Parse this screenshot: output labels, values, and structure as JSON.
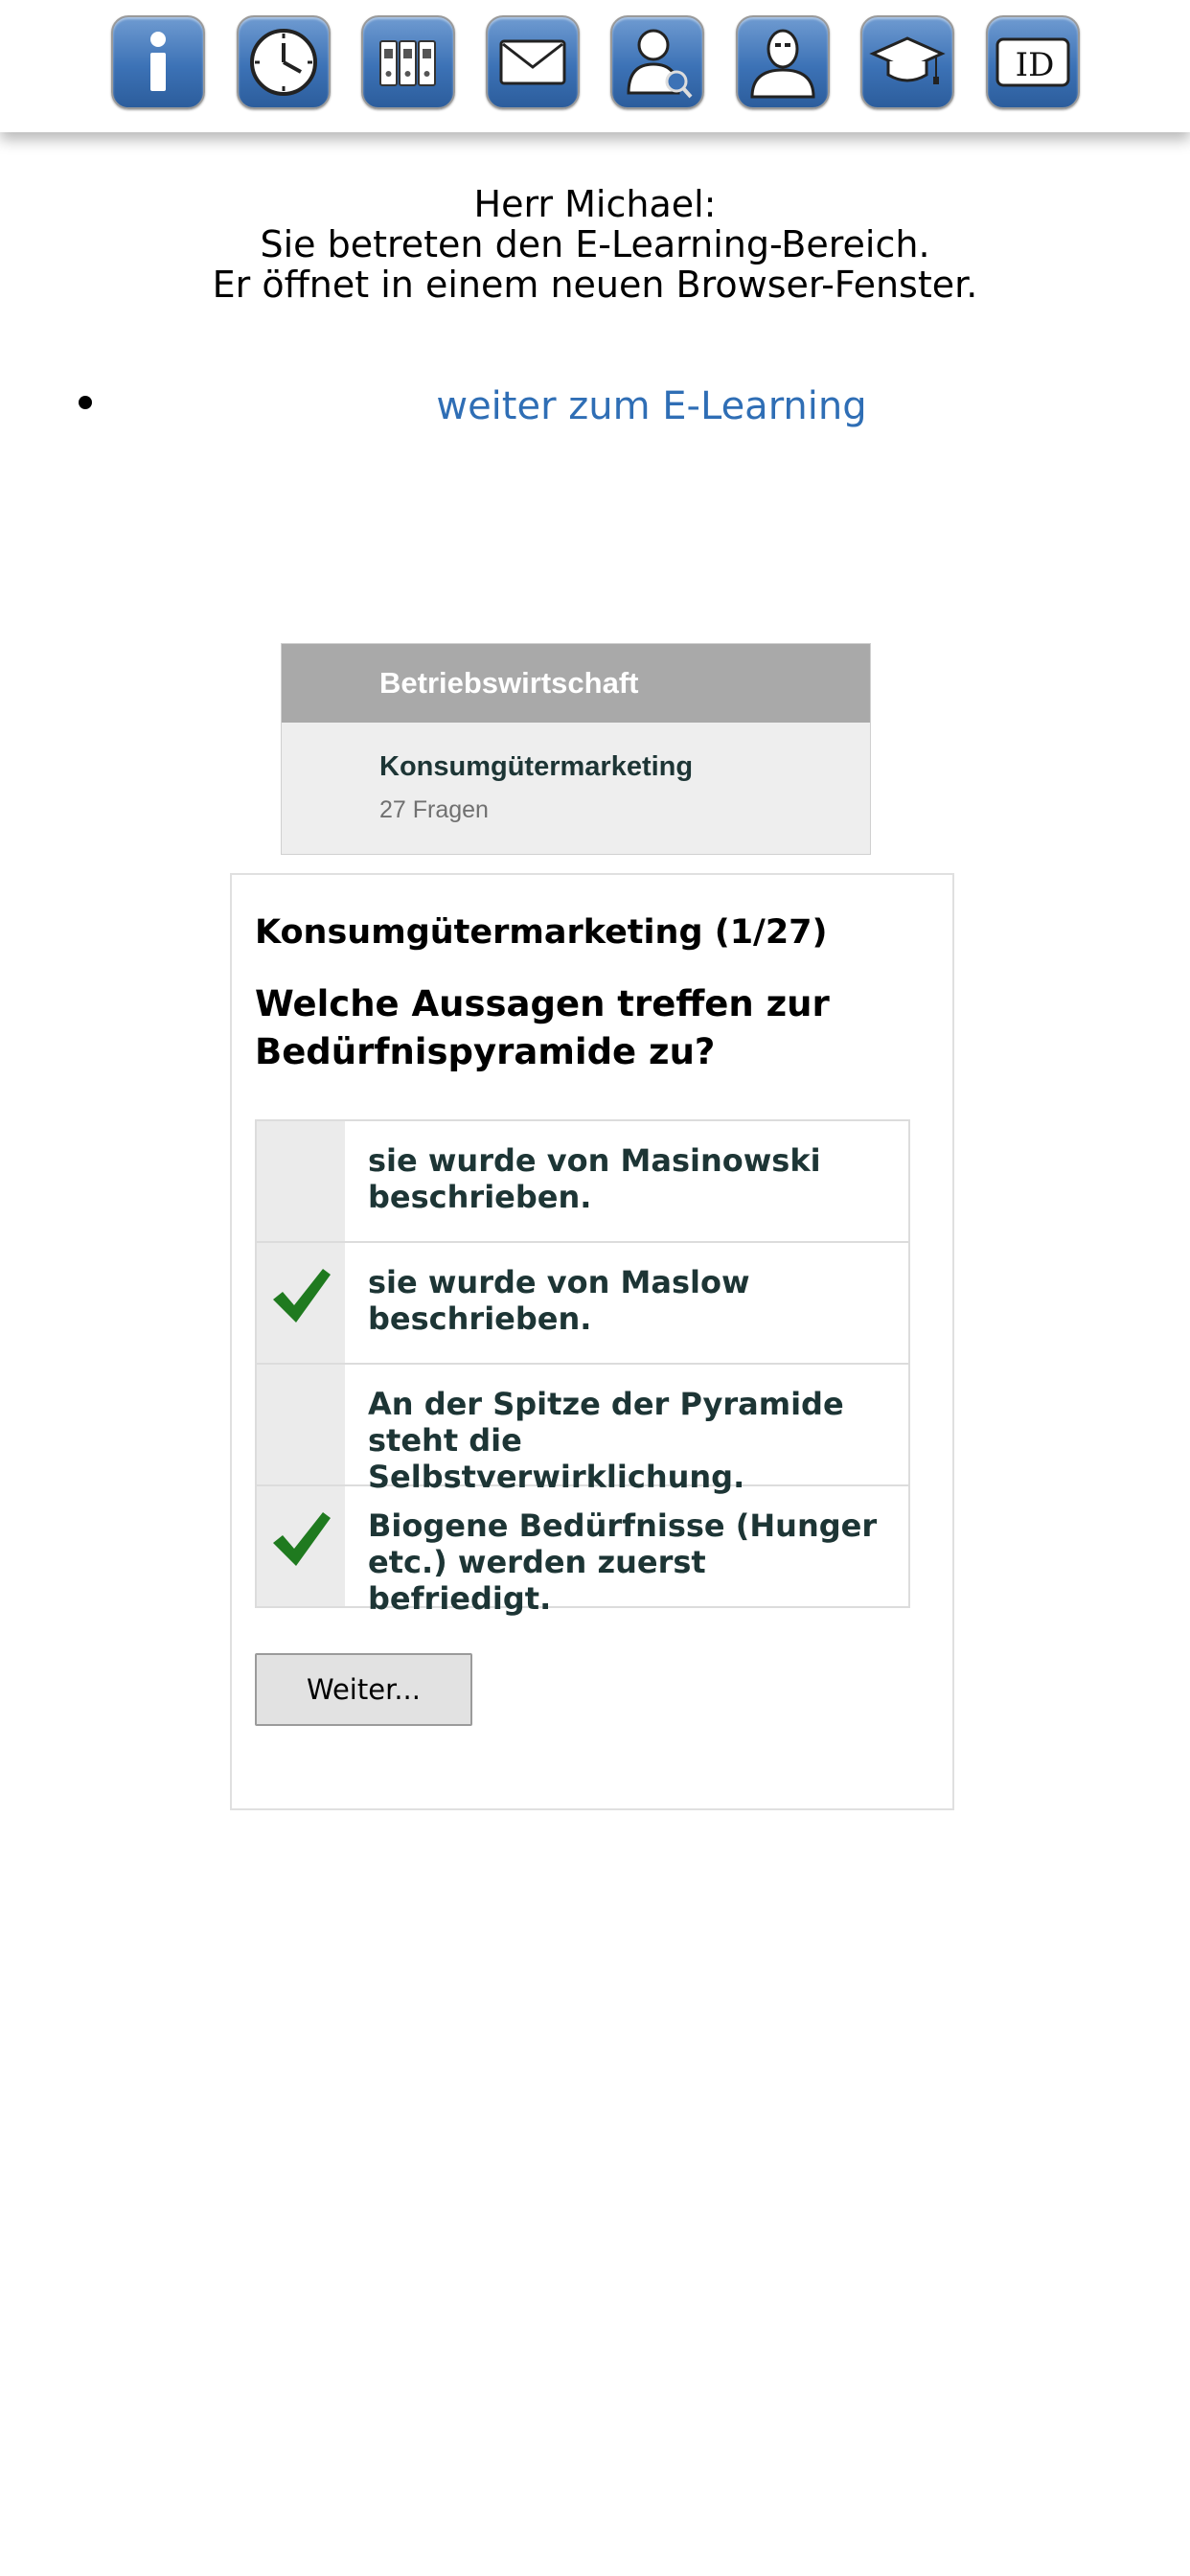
{
  "toolbar": {
    "buttons": [
      {
        "icon": "info-icon"
      },
      {
        "icon": "clock-icon"
      },
      {
        "icon": "binders-icon"
      },
      {
        "icon": "mail-icon"
      },
      {
        "icon": "user-search-icon"
      },
      {
        "icon": "user-profile-icon"
      },
      {
        "icon": "graduation-cap-icon"
      },
      {
        "icon": "id-card-icon",
        "label": "ID"
      }
    ],
    "accent_color": "#3c72b6"
  },
  "intro": {
    "line1": "Herr Michael:",
    "line2": "Sie betreten den E-Learning-Bereich.",
    "line3": "Er öffnet in einem neuen Browser-Fenster."
  },
  "elearning_link": {
    "label": "weiter zum E-Learning",
    "color": "#2f6eb5"
  },
  "category": {
    "header": "Betriebswirtschaft",
    "title": "Konsumgütermarketing",
    "count": "27 Fragen"
  },
  "quiz": {
    "title": "Konsumgütermarketing (1/27)",
    "question": "Welche Aussagen treffen zur Bedürfnispyramide zu?",
    "answers": [
      {
        "text": "sie wurde von Masinowski beschrieben.",
        "checked": false
      },
      {
        "text": "sie wurde von Maslow beschrieben.",
        "checked": true
      },
      {
        "text": "An der Spitze der Pyramide steht die Selbstverwirklichung.",
        "checked": false
      },
      {
        "text": "Biogene Bedürfnisse (Hunger etc.) werden zuerst befriedigt.",
        "checked": true
      }
    ],
    "next_label": "Weiter...",
    "check_color": "#1f7a1f"
  }
}
